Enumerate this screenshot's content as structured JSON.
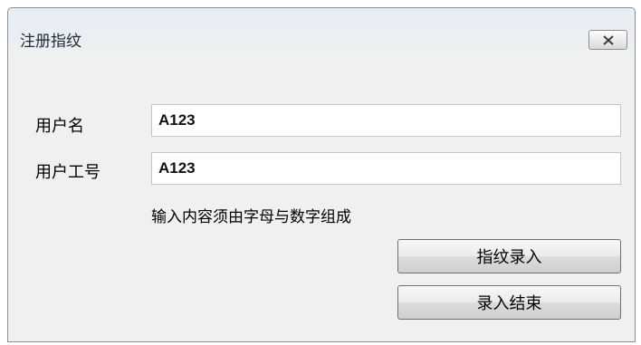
{
  "window": {
    "title": "注册指纹",
    "close_icon": "close-icon"
  },
  "form": {
    "username_label": "用户名",
    "username_value": "A123",
    "employee_id_label": "用户工号",
    "employee_id_value": "A123",
    "hint": "输入内容须由字母与数字组成"
  },
  "buttons": {
    "enroll_label": "指纹录入",
    "finish_label": "录入结束"
  }
}
